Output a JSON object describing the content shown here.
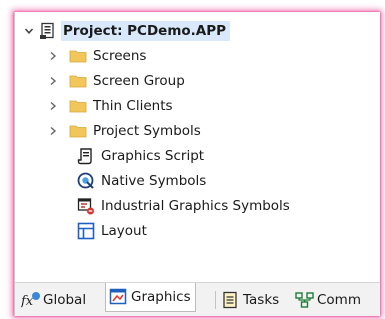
{
  "tree": {
    "root_label": "Project: PCDemo.APP",
    "items": [
      {
        "label": "Screens",
        "icon": "folder-icon",
        "expandable": true
      },
      {
        "label": "Screen Group",
        "icon": "folder-icon",
        "expandable": true
      },
      {
        "label": "Thin Clients",
        "icon": "folder-icon",
        "expandable": true
      },
      {
        "label": "Project Symbols",
        "icon": "folder-icon",
        "expandable": true
      },
      {
        "label": "Graphics Script",
        "icon": "script-icon",
        "expandable": false
      },
      {
        "label": "Native Symbols",
        "icon": "native-symbols-icon",
        "expandable": false
      },
      {
        "label": "Industrial Graphics Symbols",
        "icon": "industrial-graphics-icon",
        "expandable": false
      },
      {
        "label": "Layout",
        "icon": "layout-icon",
        "expandable": false
      }
    ]
  },
  "tabs": [
    {
      "label": "Global",
      "icon": "global-fx-icon",
      "active": false
    },
    {
      "label": "Graphics",
      "icon": "graphics-icon",
      "active": true
    },
    {
      "label": "Tasks",
      "icon": "tasks-icon",
      "active": false
    },
    {
      "label": "Comm",
      "icon": "comm-icon",
      "active": false
    }
  ],
  "colors": {
    "selection": "#d9e9fb",
    "folder": "#f1c75b",
    "highlight_glow": "#e81478"
  }
}
